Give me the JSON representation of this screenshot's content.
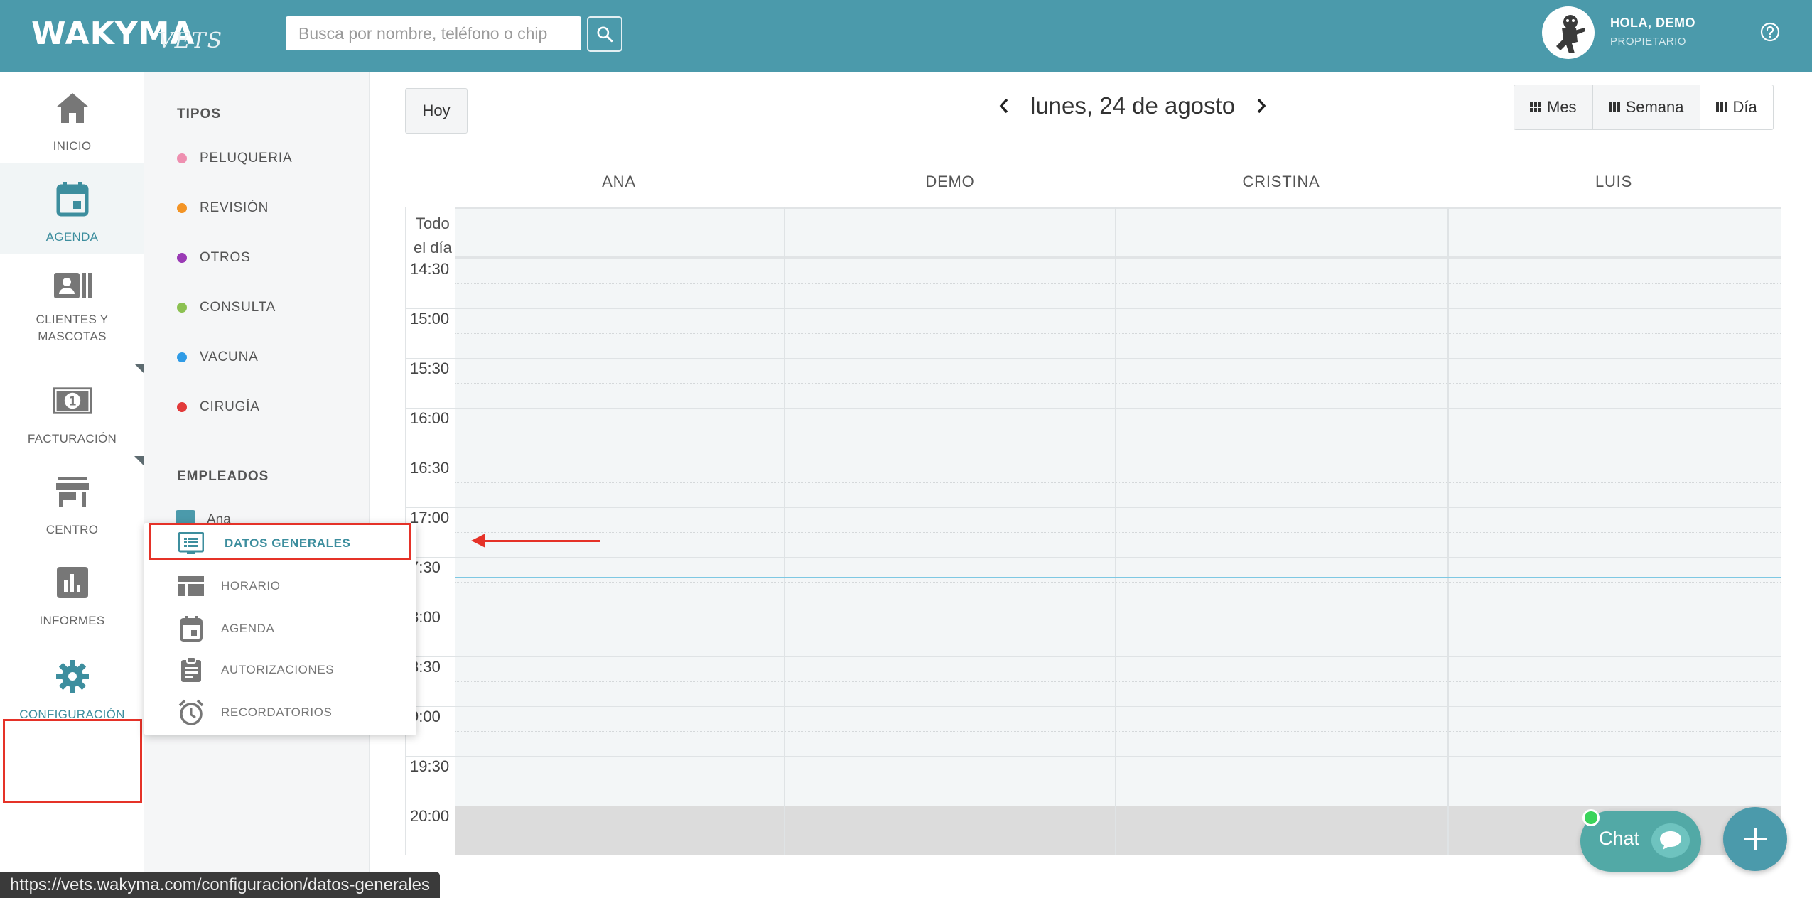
{
  "header": {
    "logo": "WAKYMA",
    "logo_sub": "VETS",
    "search_placeholder": "Busca por nombre, teléfono o chip",
    "greeting": "HOLA, DEMO",
    "role": "PROPIETARIO",
    "bg_color": "#4b9aab"
  },
  "nav": {
    "items": [
      {
        "label": "INICIO",
        "icon": "home-icon"
      },
      {
        "label": "AGENDA",
        "icon": "calendar-icon"
      },
      {
        "label": "CLIENTES Y MASCOTAS",
        "icon": "contacts-icon"
      },
      {
        "label": "FACTURACIÓN",
        "icon": "money-icon"
      },
      {
        "label": "CENTRO",
        "icon": "store-icon"
      },
      {
        "label": "INFORMES",
        "icon": "chart-icon"
      },
      {
        "label": "CONFIGURACIÓN",
        "icon": "gear-icon"
      }
    ],
    "active": "AGENDA"
  },
  "filters": {
    "types_title": "TIPOS",
    "types": [
      {
        "label": "PELUQUERIA",
        "color": "#ee8fb0"
      },
      {
        "label": "REVISIÓN",
        "color": "#f39425"
      },
      {
        "label": "OTROS",
        "color": "#9a3ab5"
      },
      {
        "label": "CONSULTA",
        "color": "#8cc152"
      },
      {
        "label": "VACUNA",
        "color": "#2f9be6"
      },
      {
        "label": "CIRUGÍA",
        "color": "#e23a3a"
      }
    ],
    "employees_title": "EMPLEADOS",
    "employees": [
      "Ana"
    ]
  },
  "config_menu": {
    "items": [
      {
        "label": "DATOS GENERALES",
        "icon": "list-icon"
      },
      {
        "label": "HORARIO",
        "icon": "table-icon"
      },
      {
        "label": "AGENDA",
        "icon": "calendar-icon"
      },
      {
        "label": "AUTORIZACIONES",
        "icon": "clipboard-icon"
      },
      {
        "label": "RECORDATORIOS",
        "icon": "alarm-icon"
      }
    ],
    "selected": "DATOS GENERALES"
  },
  "calendar": {
    "today_label": "Hoy",
    "date_label": "lunes, 24 de agosto",
    "views": [
      "Mes",
      "Semana",
      "Día"
    ],
    "columns": [
      "ANA",
      "DEMO",
      "CRISTINA",
      "LUIS"
    ],
    "allday_label": "Todo el día",
    "allday_line1": "Todo",
    "allday_line2": "el día",
    "times": [
      "14:30",
      "15:00",
      "15:30",
      "16:00",
      "16:30",
      "17:00",
      "7:30",
      "8:00",
      "8:30",
      "9:00",
      "19:30",
      "20:00"
    ]
  },
  "chat": {
    "label": "Chat"
  },
  "status_url": "https://vets.wakyma.com/configuracion/datos-generales"
}
